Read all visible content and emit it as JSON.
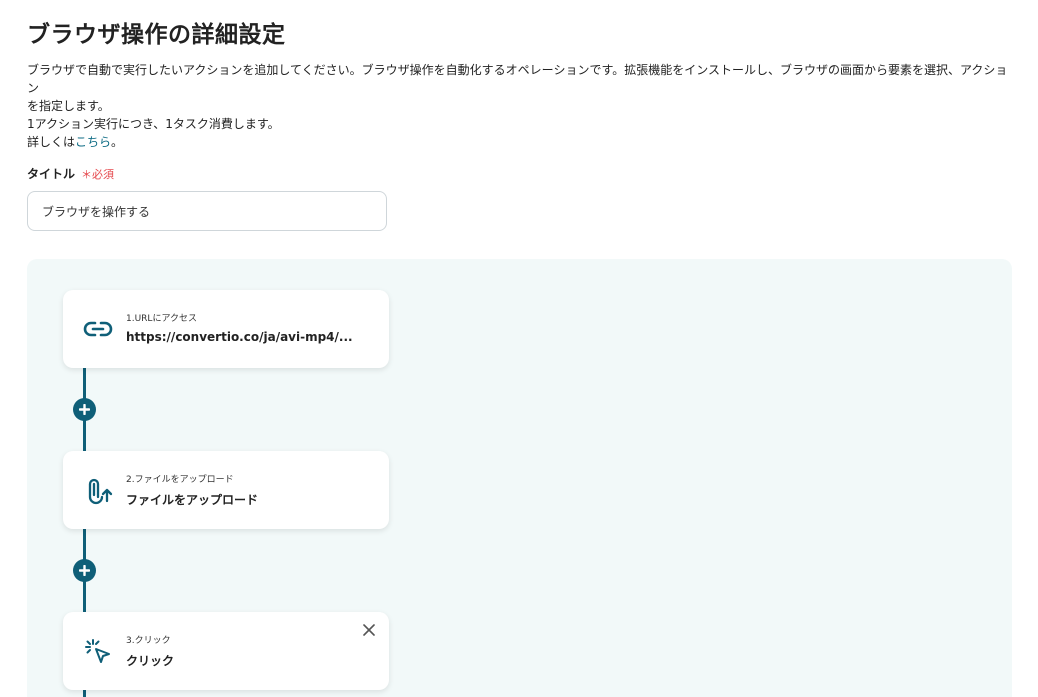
{
  "header": {
    "title": "ブラウザ操作の詳細設定"
  },
  "description": {
    "line1": "ブラウザで自動で実行したいアクションを追加してください。ブラウザ操作を自動化するオペレーションです。拡張機能をインストールし、ブラウザの画面から要素を選択、アクション",
    "line2": "を指定します。",
    "line3": "1アクション実行につき、1タスク消費します。",
    "line4_prefix": "詳しくは",
    "line4_link": "こちら",
    "line4_suffix": "。"
  },
  "title_field": {
    "label": "タイトル",
    "required": "＊必須",
    "value": "ブラウザを操作する"
  },
  "steps": [
    {
      "subtitle": "1.URLにアクセス",
      "label": "https://convertio.co/ja/avi-mp4/...",
      "icon": "link-icon"
    },
    {
      "subtitle": "2.ファイルをアップロード",
      "label": "ファイルをアップロード",
      "icon": "paperclip-upload-icon"
    },
    {
      "subtitle": "3.クリック",
      "label": "クリック",
      "icon": "cursor-click-icon"
    }
  ],
  "colors": {
    "accent": "#0f5f78",
    "link": "#0d6b84",
    "required": "#e5484d",
    "canvas_bg": "#f2f9f9"
  }
}
